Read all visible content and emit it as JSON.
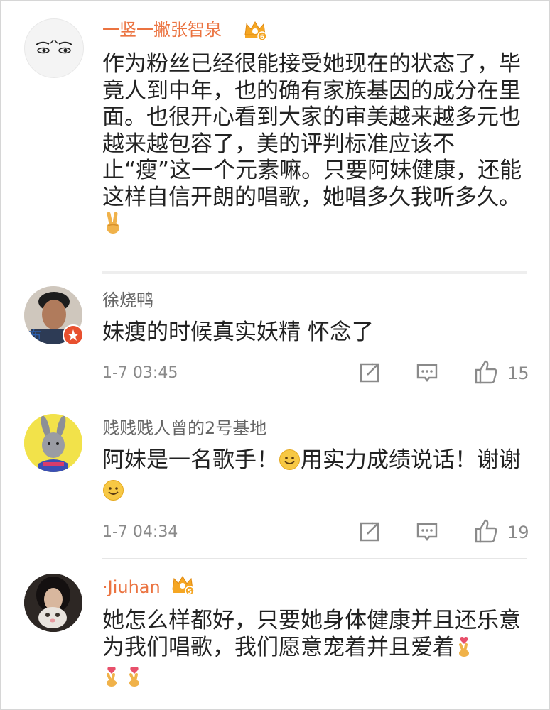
{
  "comments": [
    {
      "username": "一竖一撇张智泉",
      "vip": true,
      "crown_level": "6",
      "text": "作为粉丝已经很能接受她现在的状态了，毕竟人到中年，也的确有家族基因的成分在里面。也很开心看到大家的审美越来越多元也越来越包容了，美的评判标准应该不止“瘦”这一个元素嘛。只要阿妹健康，还能这样自信开朗的唱歌，她唱多久我听多久。",
      "emoji_after": "victory-hand"
    },
    {
      "username": "徐烧鸭",
      "vip": false,
      "text": "妹瘦的时候真实妖精 怀念了",
      "time": "1-7 03:45",
      "likes": "15"
    },
    {
      "username": "贱贱贱人曾的2号基地",
      "vip": false,
      "text_part1": "阿妹是一名歌手！",
      "text_part2": "用实力成绩说话！谢谢",
      "time": "1-7 04:34",
      "likes": "19"
    },
    {
      "username": "·Jiuhan",
      "vip": true,
      "crown_level": "5",
      "text": "她怎么样都好，只要她身体健康并且还乐意为我们唱歌，我们愿意宠着并且爱着"
    }
  ],
  "icons": {
    "repost": "repost-icon",
    "comment": "comment-icon",
    "like": "like-icon",
    "crown": "vip-crown-icon"
  },
  "colors": {
    "vip_name": "#eb7340",
    "name": "#666666",
    "meta": "#8a8a8a",
    "text": "#222222",
    "crown": "#f5a623"
  }
}
